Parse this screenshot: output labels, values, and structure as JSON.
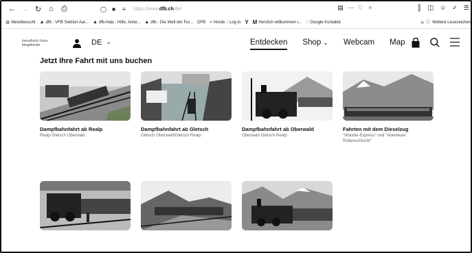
{
  "browser": {
    "url_prefix": "https://www.",
    "url_domain": "dfb.ch",
    "url_path": "/de/",
    "bookmarks": [
      {
        "icon": "gear-icon",
        "label": "Meistbesucht"
      },
      {
        "icon": "dfb-icon",
        "label": "dfb - VFB Sektion Aar..."
      },
      {
        "icon": "dfb-icon",
        "label": "dfb-help - Hilfe, Anlei..."
      },
      {
        "icon": "dfb-icon",
        "label": "dfb - Die Welt der Fur..."
      },
      {
        "icon": "none",
        "label": "DFB"
      },
      {
        "icon": "horde-icon",
        "label": "Horde :: Log in"
      },
      {
        "icon": "y-icon",
        "label": ""
      },
      {
        "icon": "m-icon",
        "label": "Herzlich willkommen i..."
      },
      {
        "icon": "page-icon",
        "label": "Google Kontakte"
      }
    ],
    "more_bookmarks": "Weitere Lesezeichen"
  },
  "header": {
    "logo_line1": "dampfbahn furka",
    "logo_line2": "bergstrecke",
    "language": "DE",
    "nav": [
      {
        "label": "Entdecken",
        "active": true
      },
      {
        "label": "Shop",
        "dropdown": true
      },
      {
        "label": "Webcam"
      },
      {
        "label": "Map"
      }
    ]
  },
  "main": {
    "section_title": "Jetzt Ihre Fahrt mit uns buchen",
    "cards": [
      {
        "title": "Dampfbahnfahrt ab Realp",
        "subtitle": "Realp·Gletsch·Oberwald"
      },
      {
        "title": "Dampfbahnfahrt ab Gletsch",
        "subtitle": "Gletsch·Oberwald/Gletsch·Realp"
      },
      {
        "title": "Dampfbahnfahrt ab Oberwald",
        "subtitle": "Oberwald·Gletsch·Realp"
      },
      {
        "title": "Fahrten mit dem Dieselzug",
        "subtitle": "\"Wander-Express\" und \"Abenteuer Rottenschlucht\""
      },
      {
        "title": "",
        "subtitle": ""
      },
      {
        "title": "",
        "subtitle": ""
      },
      {
        "title": "",
        "subtitle": ""
      }
    ]
  }
}
